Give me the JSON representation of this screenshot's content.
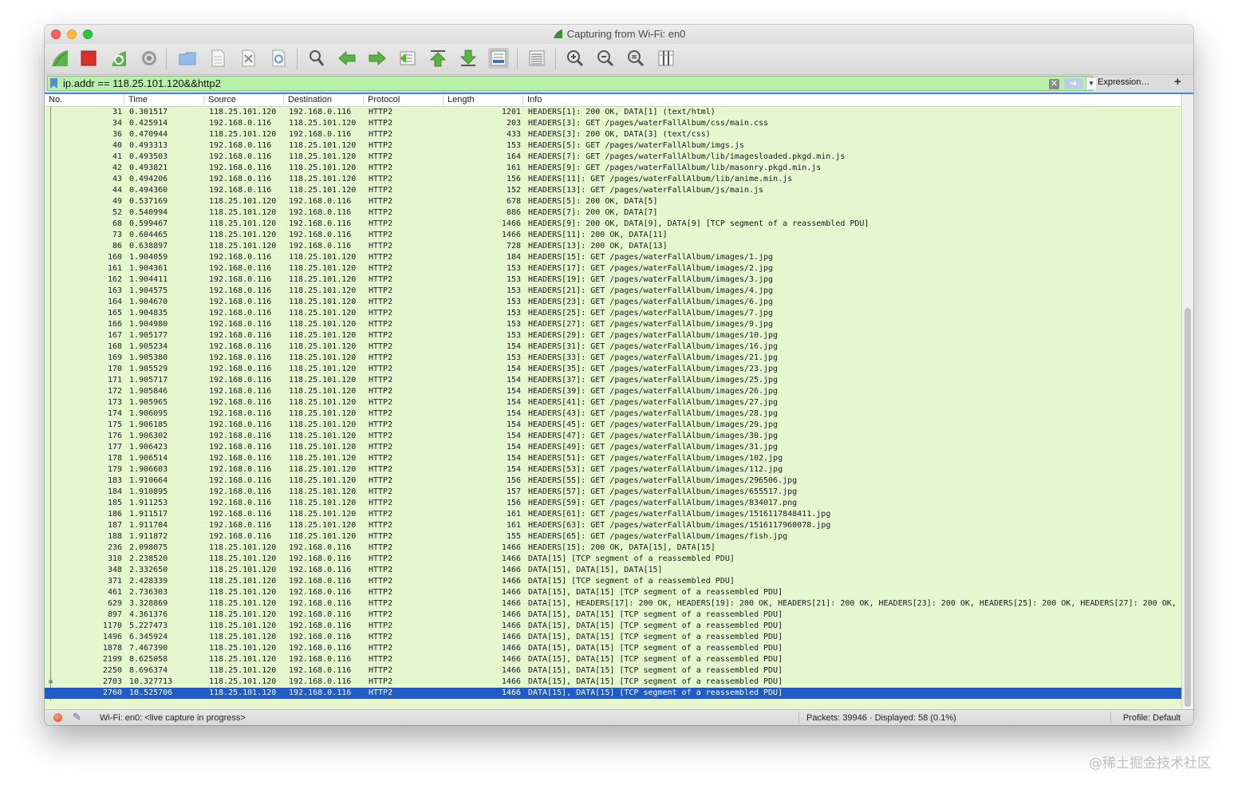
{
  "window": {
    "title": "Capturing from Wi-Fi: en0"
  },
  "toolbar": {
    "buttons": [
      "start-capture-icon",
      "stop-capture-icon",
      "restart-capture-icon",
      "capture-options-icon",
      "open-file-icon",
      "save-file-icon",
      "close-file-icon",
      "reload-file-icon",
      "find-packet-icon",
      "go-back-icon",
      "go-forward-icon",
      "go-to-packet-icon",
      "first-packet-icon",
      "last-packet-icon",
      "autoscroll-icon",
      "colorize-icon",
      "zoom-in-icon",
      "zoom-out-icon",
      "normal-size-icon",
      "resize-columns-icon"
    ]
  },
  "filter": {
    "value": "ip.addr == 118.25.101.120&&http2",
    "clear_glyph": "✕",
    "apply_glyph": "➔",
    "dropdown_glyph": "▼",
    "expression_label": "Expression…",
    "plus_label": "+",
    "background": "#b8f0a8"
  },
  "columns": {
    "no": "No.",
    "time": "Time",
    "source": "Source",
    "destination": "Destination",
    "protocol": "Protocol",
    "length": "Length",
    "info": "Info"
  },
  "packets": [
    {
      "no": "31",
      "time": "0.301517",
      "src": "118.25.101.120",
      "dst": "192.168.0.116",
      "proto": "HTTP2",
      "len": "1201",
      "info": "HEADERS[1]: 200 OK, DATA[1] (text/html)"
    },
    {
      "no": "34",
      "time": "0.425914",
      "src": "192.168.0.116",
      "dst": "118.25.101.120",
      "proto": "HTTP2",
      "len": "203",
      "info": "HEADERS[3]: GET /pages/waterFallAlbum/css/main.css"
    },
    {
      "no": "36",
      "time": "0.470944",
      "src": "118.25.101.120",
      "dst": "192.168.0.116",
      "proto": "HTTP2",
      "len": "433",
      "info": "HEADERS[3]: 200 OK, DATA[3] (text/css)"
    },
    {
      "no": "40",
      "time": "0.493313",
      "src": "192.168.0.116",
      "dst": "118.25.101.120",
      "proto": "HTTP2",
      "len": "153",
      "info": "HEADERS[5]: GET /pages/waterFallAlbum/imgs.js"
    },
    {
      "no": "41",
      "time": "0.493503",
      "src": "192.168.0.116",
      "dst": "118.25.101.120",
      "proto": "HTTP2",
      "len": "164",
      "info": "HEADERS[7]: GET /pages/waterFallAlbum/lib/imagesloaded.pkgd.min.js"
    },
    {
      "no": "42",
      "time": "0.493821",
      "src": "192.168.0.116",
      "dst": "118.25.101.120",
      "proto": "HTTP2",
      "len": "161",
      "info": "HEADERS[9]: GET /pages/waterFallAlbum/lib/masonry.pkgd.min.js"
    },
    {
      "no": "43",
      "time": "0.494206",
      "src": "192.168.0.116",
      "dst": "118.25.101.120",
      "proto": "HTTP2",
      "len": "156",
      "info": "HEADERS[11]: GET /pages/waterFallAlbum/lib/anime.min.js"
    },
    {
      "no": "44",
      "time": "0.494360",
      "src": "192.168.0.116",
      "dst": "118.25.101.120",
      "proto": "HTTP2",
      "len": "152",
      "info": "HEADERS[13]: GET /pages/waterFallAlbum/js/main.js"
    },
    {
      "no": "49",
      "time": "0.537169",
      "src": "118.25.101.120",
      "dst": "192.168.0.116",
      "proto": "HTTP2",
      "len": "678",
      "info": "HEADERS[5]: 200 OK, DATA[5]"
    },
    {
      "no": "52",
      "time": "0.540994",
      "src": "118.25.101.120",
      "dst": "192.168.0.116",
      "proto": "HTTP2",
      "len": "886",
      "info": "HEADERS[7]: 200 OK, DATA[7]"
    },
    {
      "no": "68",
      "time": "0.599467",
      "src": "118.25.101.120",
      "dst": "192.168.0.116",
      "proto": "HTTP2",
      "len": "1466",
      "info": "HEADERS[9]: 200 OK, DATA[9], DATA[9] [TCP segment of a reassembled PDU]"
    },
    {
      "no": "73",
      "time": "0.604465",
      "src": "118.25.101.120",
      "dst": "192.168.0.116",
      "proto": "HTTP2",
      "len": "1466",
      "info": "HEADERS[11]: 200 OK, DATA[11]"
    },
    {
      "no": "86",
      "time": "0.638897",
      "src": "118.25.101.120",
      "dst": "192.168.0.116",
      "proto": "HTTP2",
      "len": "728",
      "info": "HEADERS[13]: 200 OK, DATA[13]"
    },
    {
      "no": "160",
      "time": "1.904059",
      "src": "192.168.0.116",
      "dst": "118.25.101.120",
      "proto": "HTTP2",
      "len": "184",
      "info": "HEADERS[15]: GET /pages/waterFallAlbum/images/1.jpg"
    },
    {
      "no": "161",
      "time": "1.904361",
      "src": "192.168.0.116",
      "dst": "118.25.101.120",
      "proto": "HTTP2",
      "len": "153",
      "info": "HEADERS[17]: GET /pages/waterFallAlbum/images/2.jpg"
    },
    {
      "no": "162",
      "time": "1.904411",
      "src": "192.168.0.116",
      "dst": "118.25.101.120",
      "proto": "HTTP2",
      "len": "153",
      "info": "HEADERS[19]: GET /pages/waterFallAlbum/images/3.jpg"
    },
    {
      "no": "163",
      "time": "1.904575",
      "src": "192.168.0.116",
      "dst": "118.25.101.120",
      "proto": "HTTP2",
      "len": "153",
      "info": "HEADERS[21]: GET /pages/waterFallAlbum/images/4.jpg"
    },
    {
      "no": "164",
      "time": "1.904670",
      "src": "192.168.0.116",
      "dst": "118.25.101.120",
      "proto": "HTTP2",
      "len": "153",
      "info": "HEADERS[23]: GET /pages/waterFallAlbum/images/6.jpg"
    },
    {
      "no": "165",
      "time": "1.904835",
      "src": "192.168.0.116",
      "dst": "118.25.101.120",
      "proto": "HTTP2",
      "len": "153",
      "info": "HEADERS[25]: GET /pages/waterFallAlbum/images/7.jpg"
    },
    {
      "no": "166",
      "time": "1.904980",
      "src": "192.168.0.116",
      "dst": "118.25.101.120",
      "proto": "HTTP2",
      "len": "153",
      "info": "HEADERS[27]: GET /pages/waterFallAlbum/images/9.jpg"
    },
    {
      "no": "167",
      "time": "1.905177",
      "src": "192.168.0.116",
      "dst": "118.25.101.120",
      "proto": "HTTP2",
      "len": "153",
      "info": "HEADERS[29]: GET /pages/waterFallAlbum/images/10.jpg"
    },
    {
      "no": "168",
      "time": "1.905234",
      "src": "192.168.0.116",
      "dst": "118.25.101.120",
      "proto": "HTTP2",
      "len": "154",
      "info": "HEADERS[31]: GET /pages/waterFallAlbum/images/16.jpg"
    },
    {
      "no": "169",
      "time": "1.905380",
      "src": "192.168.0.116",
      "dst": "118.25.101.120",
      "proto": "HTTP2",
      "len": "153",
      "info": "HEADERS[33]: GET /pages/waterFallAlbum/images/21.jpg"
    },
    {
      "no": "170",
      "time": "1.905529",
      "src": "192.168.0.116",
      "dst": "118.25.101.120",
      "proto": "HTTP2",
      "len": "154",
      "info": "HEADERS[35]: GET /pages/waterFallAlbum/images/23.jpg"
    },
    {
      "no": "171",
      "time": "1.905717",
      "src": "192.168.0.116",
      "dst": "118.25.101.120",
      "proto": "HTTP2",
      "len": "154",
      "info": "HEADERS[37]: GET /pages/waterFallAlbum/images/25.jpg"
    },
    {
      "no": "172",
      "time": "1.905846",
      "src": "192.168.0.116",
      "dst": "118.25.101.120",
      "proto": "HTTP2",
      "len": "154",
      "info": "HEADERS[39]: GET /pages/waterFallAlbum/images/26.jpg"
    },
    {
      "no": "173",
      "time": "1.905965",
      "src": "192.168.0.116",
      "dst": "118.25.101.120",
      "proto": "HTTP2",
      "len": "154",
      "info": "HEADERS[41]: GET /pages/waterFallAlbum/images/27.jpg"
    },
    {
      "no": "174",
      "time": "1.906095",
      "src": "192.168.0.116",
      "dst": "118.25.101.120",
      "proto": "HTTP2",
      "len": "154",
      "info": "HEADERS[43]: GET /pages/waterFallAlbum/images/28.jpg"
    },
    {
      "no": "175",
      "time": "1.906185",
      "src": "192.168.0.116",
      "dst": "118.25.101.120",
      "proto": "HTTP2",
      "len": "154",
      "info": "HEADERS[45]: GET /pages/waterFallAlbum/images/29.jpg"
    },
    {
      "no": "176",
      "time": "1.906302",
      "src": "192.168.0.116",
      "dst": "118.25.101.120",
      "proto": "HTTP2",
      "len": "154",
      "info": "HEADERS[47]: GET /pages/waterFallAlbum/images/30.jpg"
    },
    {
      "no": "177",
      "time": "1.906423",
      "src": "192.168.0.116",
      "dst": "118.25.101.120",
      "proto": "HTTP2",
      "len": "154",
      "info": "HEADERS[49]: GET /pages/waterFallAlbum/images/31.jpg"
    },
    {
      "no": "178",
      "time": "1.906514",
      "src": "192.168.0.116",
      "dst": "118.25.101.120",
      "proto": "HTTP2",
      "len": "154",
      "info": "HEADERS[51]: GET /pages/waterFallAlbum/images/102.jpg"
    },
    {
      "no": "179",
      "time": "1.906603",
      "src": "192.168.0.116",
      "dst": "118.25.101.120",
      "proto": "HTTP2",
      "len": "154",
      "info": "HEADERS[53]: GET /pages/waterFallAlbum/images/112.jpg"
    },
    {
      "no": "183",
      "time": "1.910664",
      "src": "192.168.0.116",
      "dst": "118.25.101.120",
      "proto": "HTTP2",
      "len": "156",
      "info": "HEADERS[55]: GET /pages/waterFallAlbum/images/296506.jpg"
    },
    {
      "no": "184",
      "time": "1.910895",
      "src": "192.168.0.116",
      "dst": "118.25.101.120",
      "proto": "HTTP2",
      "len": "157",
      "info": "HEADERS[57]: GET /pages/waterFallAlbum/images/655517.jpg"
    },
    {
      "no": "185",
      "time": "1.911253",
      "src": "192.168.0.116",
      "dst": "118.25.101.120",
      "proto": "HTTP2",
      "len": "156",
      "info": "HEADERS[59]: GET /pages/waterFallAlbum/images/834017.png"
    },
    {
      "no": "186",
      "time": "1.911517",
      "src": "192.168.0.116",
      "dst": "118.25.101.120",
      "proto": "HTTP2",
      "len": "161",
      "info": "HEADERS[61]: GET /pages/waterFallAlbum/images/1516117848411.jpg"
    },
    {
      "no": "187",
      "time": "1.911704",
      "src": "192.168.0.116",
      "dst": "118.25.101.120",
      "proto": "HTTP2",
      "len": "161",
      "info": "HEADERS[63]: GET /pages/waterFallAlbum/images/1516117960078.jpg"
    },
    {
      "no": "188",
      "time": "1.911872",
      "src": "192.168.0.116",
      "dst": "118.25.101.120",
      "proto": "HTTP2",
      "len": "155",
      "info": "HEADERS[65]: GET /pages/waterFallAlbum/images/fish.jpg"
    },
    {
      "no": "236",
      "time": "2.098075",
      "src": "118.25.101.120",
      "dst": "192.168.0.116",
      "proto": "HTTP2",
      "len": "1466",
      "info": "HEADERS[15]: 200 OK, DATA[15], DATA[15]"
    },
    {
      "no": "310",
      "time": "2.238520",
      "src": "118.25.101.120",
      "dst": "192.168.0.116",
      "proto": "HTTP2",
      "len": "1466",
      "info": "DATA[15] [TCP segment of a reassembled PDU]"
    },
    {
      "no": "348",
      "time": "2.332650",
      "src": "118.25.101.120",
      "dst": "192.168.0.116",
      "proto": "HTTP2",
      "len": "1466",
      "info": "DATA[15], DATA[15], DATA[15]"
    },
    {
      "no": "371",
      "time": "2.428339",
      "src": "118.25.101.120",
      "dst": "192.168.0.116",
      "proto": "HTTP2",
      "len": "1466",
      "info": "DATA[15] [TCP segment of a reassembled PDU]"
    },
    {
      "no": "461",
      "time": "2.736303",
      "src": "118.25.101.120",
      "dst": "192.168.0.116",
      "proto": "HTTP2",
      "len": "1466",
      "info": "DATA[15], DATA[15] [TCP segment of a reassembled PDU]"
    },
    {
      "no": "629",
      "time": "3.328869",
      "src": "118.25.101.120",
      "dst": "192.168.0.116",
      "proto": "HTTP2",
      "len": "1466",
      "info": "DATA[15], HEADERS[17]: 200 OK, HEADERS[19]: 200 OK, HEADERS[21]: 200 OK, HEADERS[23]: 200 OK, HEADERS[25]: 200 OK, HEADERS[27]: 200 OK,"
    },
    {
      "no": "897",
      "time": "4.361376",
      "src": "118.25.101.120",
      "dst": "192.168.0.116",
      "proto": "HTTP2",
      "len": "1466",
      "info": "DATA[15], DATA[15] [TCP segment of a reassembled PDU]"
    },
    {
      "no": "1170",
      "time": "5.227473",
      "src": "118.25.101.120",
      "dst": "192.168.0.116",
      "proto": "HTTP2",
      "len": "1466",
      "info": "DATA[15], DATA[15] [TCP segment of a reassembled PDU]"
    },
    {
      "no": "1496",
      "time": "6.345924",
      "src": "118.25.101.120",
      "dst": "192.168.0.116",
      "proto": "HTTP2",
      "len": "1466",
      "info": "DATA[15], DATA[15] [TCP segment of a reassembled PDU]"
    },
    {
      "no": "1878",
      "time": "7.467390",
      "src": "118.25.101.120",
      "dst": "192.168.0.116",
      "proto": "HTTP2",
      "len": "1466",
      "info": "DATA[15], DATA[15] [TCP segment of a reassembled PDU]"
    },
    {
      "no": "2199",
      "time": "8.625058",
      "src": "118.25.101.120",
      "dst": "192.168.0.116",
      "proto": "HTTP2",
      "len": "1466",
      "info": "DATA[15], DATA[15] [TCP segment of a reassembled PDU]"
    },
    {
      "no": "2250",
      "time": "8.696374",
      "src": "118.25.101.120",
      "dst": "192.168.0.116",
      "proto": "HTTP2",
      "len": "1466",
      "info": "DATA[15], DATA[15] [TCP segment of a reassembled PDU]"
    },
    {
      "no": "2703",
      "time": "10.327713",
      "src": "118.25.101.120",
      "dst": "192.168.0.116",
      "proto": "HTTP2",
      "len": "1466",
      "info": "DATA[15], DATA[15] [TCP segment of a reassembled PDU]"
    },
    {
      "no": "2760",
      "time": "10.525706",
      "src": "118.25.101.120",
      "dst": "192.168.0.116",
      "proto": "HTTP2",
      "len": "1466",
      "info": "DATA[15], DATA[15] [TCP segment of a reassembled PDU]",
      "selected": true
    }
  ],
  "colors": {
    "row_background": "#e4f7cf",
    "selected_row": "#1f5cc9",
    "selection_border": "#3b8be6"
  },
  "status": {
    "capture_text": "Wi-Fi: en0: <live capture in progress>",
    "packets_text": "Packets: 39946 · Displayed: 58 (0.1%)",
    "profile_text": "Profile: Default"
  },
  "watermark": "@稀土掘金技术社区"
}
